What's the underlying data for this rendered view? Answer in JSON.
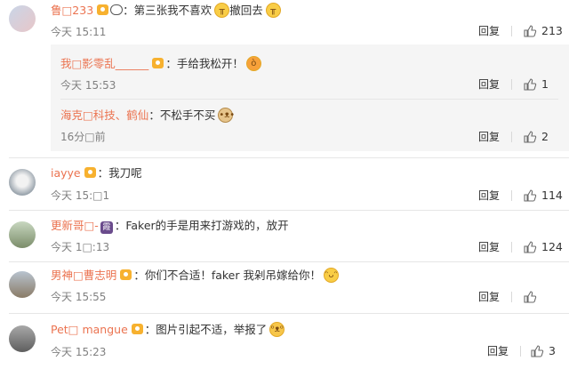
{
  "colors": {
    "username": "#eb7350",
    "text": "#333333",
    "time": "#808080",
    "nested_bg": "#f5f5f5",
    "badge": "#f7b12f"
  },
  "actions": {
    "reply_label": "回复"
  },
  "comments": [
    {
      "user": "鲁□233",
      "text": "：第三张我不喜欢",
      "text2": "撤回去",
      "emoji1": "crying-face-icon",
      "emoji2": "crying-face-icon",
      "time": "今天 15:11",
      "likes": "213"
    },
    {
      "user": "我□影零乱______",
      "text": "：手给我松开！",
      "emoji1": "angry-face-icon",
      "time": "今天 15:53",
      "likes": "1"
    },
    {
      "user": "海克□科技、鹤仙",
      "text": "：不松手不买",
      "emoji1": "doge-face-icon",
      "time": "16分□前",
      "likes": "2"
    },
    {
      "user": "iayye",
      "text": "：我刀呢",
      "time": "今天 15:□1",
      "likes": "114"
    },
    {
      "user": "更新哥□-",
      "vip": "霞",
      "text": "：Faker的手是用来打游戏的，放开",
      "time": "今天 1□:13",
      "likes": "124"
    },
    {
      "user": "男神□曹志明",
      "text": "：你们不合适！faker 我剁吊嫁给你！",
      "emoji1": "laughing-tears-icon",
      "time": "今天 15:55",
      "likes": ""
    },
    {
      "user": "Pet□ mangue",
      "text": "：图片引起不适，举报了",
      "emoji1": "cat-face-icon",
      "time": "今天 15:23",
      "likes": "3"
    }
  ]
}
